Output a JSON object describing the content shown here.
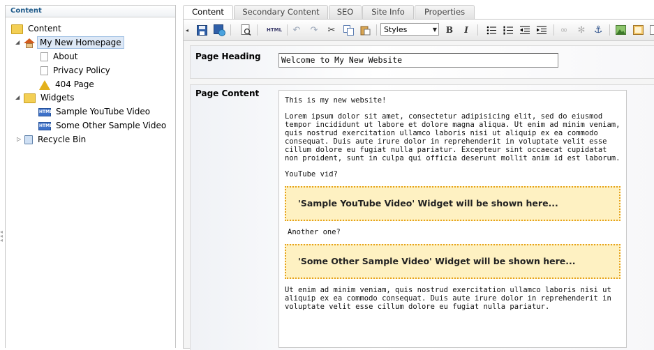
{
  "tree": {
    "header": "Content",
    "items": [
      {
        "label": "Content",
        "icon": "folder-icon"
      },
      {
        "label": "My New Homepage",
        "icon": "home-icon",
        "selected": true
      },
      {
        "label": "About",
        "icon": "page-icon"
      },
      {
        "label": "Privacy Policy",
        "icon": "page-icon"
      },
      {
        "label": "404 Page",
        "icon": "warning-page-icon"
      },
      {
        "label": "Widgets",
        "icon": "folder-icon"
      },
      {
        "label": "Sample YouTube Video",
        "icon": "html-widget-icon"
      },
      {
        "label": "Some Other Sample Video",
        "icon": "html-widget-icon"
      },
      {
        "label": "Recycle Bin",
        "icon": "recycle-bin-icon"
      }
    ]
  },
  "tabs": [
    "Content",
    "Secondary Content",
    "SEO",
    "Site Info",
    "Properties"
  ],
  "active_tab": "Content",
  "toolbar": {
    "html_label": "HTML",
    "styles_value": "Styles",
    "bold_label": "B",
    "italic_label": "I"
  },
  "fields": {
    "page_heading_label": "Page Heading",
    "page_heading_value": "Welcome to My New Website",
    "page_content_label": "Page Content"
  },
  "content": {
    "intro": "This is my new website!",
    "lorem": "Lorem ipsum dolor sit amet, consectetur adipisicing elit, sed do eiusmod tempor incididunt ut labore et dolore magna aliqua. Ut enim ad minim veniam, quis nostrud exercitation ullamco laboris nisi ut aliquip ex ea commodo consequat. Duis aute irure dolor in reprehenderit in voluptate velit esse cillum dolore eu fugiat nulla pariatur. Excepteur sint occaecat cupidatat non proident, sunt in culpa qui officia deserunt mollit anim id est laborum.",
    "youtube_label": "YouTube vid?",
    "widget1": "'Sample YouTube Video' Widget will be shown here...",
    "another_label": "Another one?",
    "widget2": "'Some Other Sample Video' Widget will be shown here...",
    "outro": "Ut enim ad minim veniam, quis nostrud exercitation ullamco laboris nisi ut aliquip ex ea commodo consequat. Duis aute irure dolor in reprehenderit in voluptate velit esse cillum dolore eu fugiat nulla pariatur."
  },
  "colors": {
    "widget_border": "#e6a21a",
    "widget_background": "#fef1c2",
    "tree_header_text": "#1e5a8a",
    "selected_item_bg": "#dde8f6"
  }
}
